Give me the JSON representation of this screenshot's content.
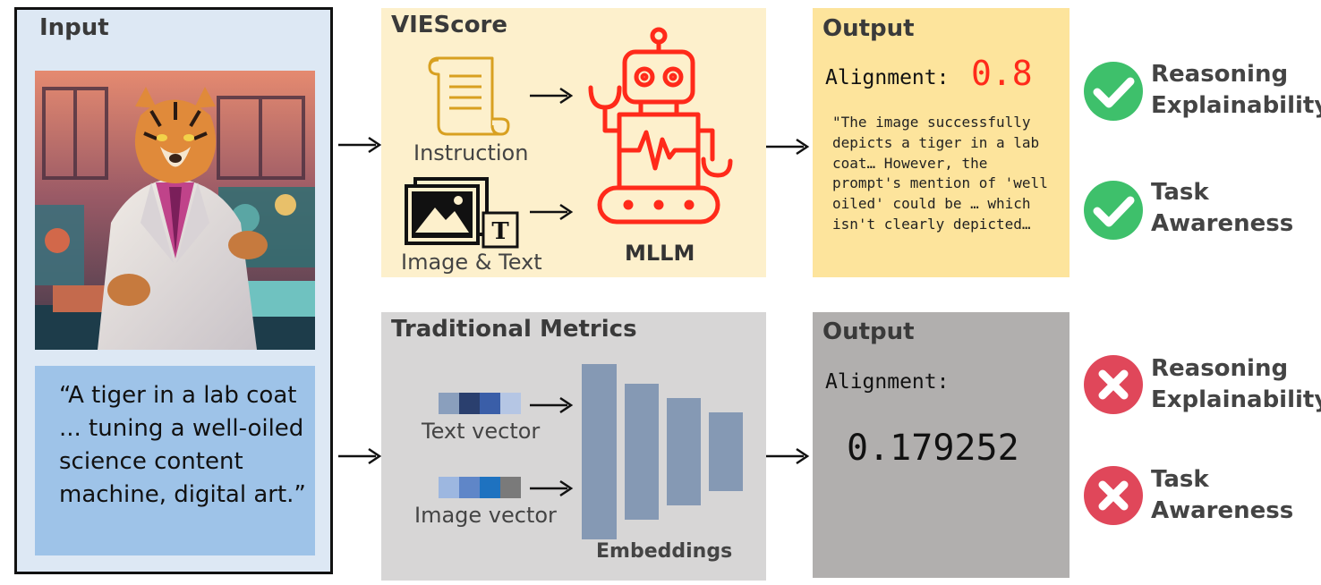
{
  "input": {
    "title": "Input",
    "prompt": "“A tiger in a lab coat ... tuning a well-oiled science content machine, digital art.”"
  },
  "viescore": {
    "title": "VIEScore",
    "instruction_label": "Instruction",
    "image_text_label": "Image & Text",
    "mllm_label": "MLLM"
  },
  "output_top": {
    "title": "Output",
    "alignment_label": "Alignment:",
    "alignment_value": "0.8",
    "explanation": "\"The image successfully depicts a tiger in a lab coat… However, the prompt's mention of 'well oiled' could be … which isn't clearly depicted…"
  },
  "traditional": {
    "title": "Traditional Metrics",
    "text_vector_label": "Text vector",
    "image_vector_label": "Image vector",
    "embeddings_label": "Embeddings",
    "text_vector_colors": [
      "#8a9fbd",
      "#2a3f6e",
      "#3a5ea8",
      "#b5c6e4"
    ],
    "image_vector_colors": [
      "#9db7e0",
      "#5f86c8",
      "#1e72c0",
      "#7a7a7a"
    ]
  },
  "output_bottom": {
    "title": "Output",
    "alignment_label": "Alignment:",
    "alignment_value": "0.179252"
  },
  "properties_top": {
    "reasoning": [
      "Reasoning",
      "Explainability"
    ],
    "task": [
      "Task",
      "Awareness"
    ]
  },
  "properties_bottom": {
    "reasoning": [
      "Reasoning",
      "Explainability"
    ],
    "task": [
      "Task",
      "Awareness"
    ]
  },
  "colors": {
    "check_green": "#3ec06b",
    "cross_red": "#e0475a",
    "robot_red": "#ff2a1a",
    "score_red": "#ff2a1a"
  }
}
